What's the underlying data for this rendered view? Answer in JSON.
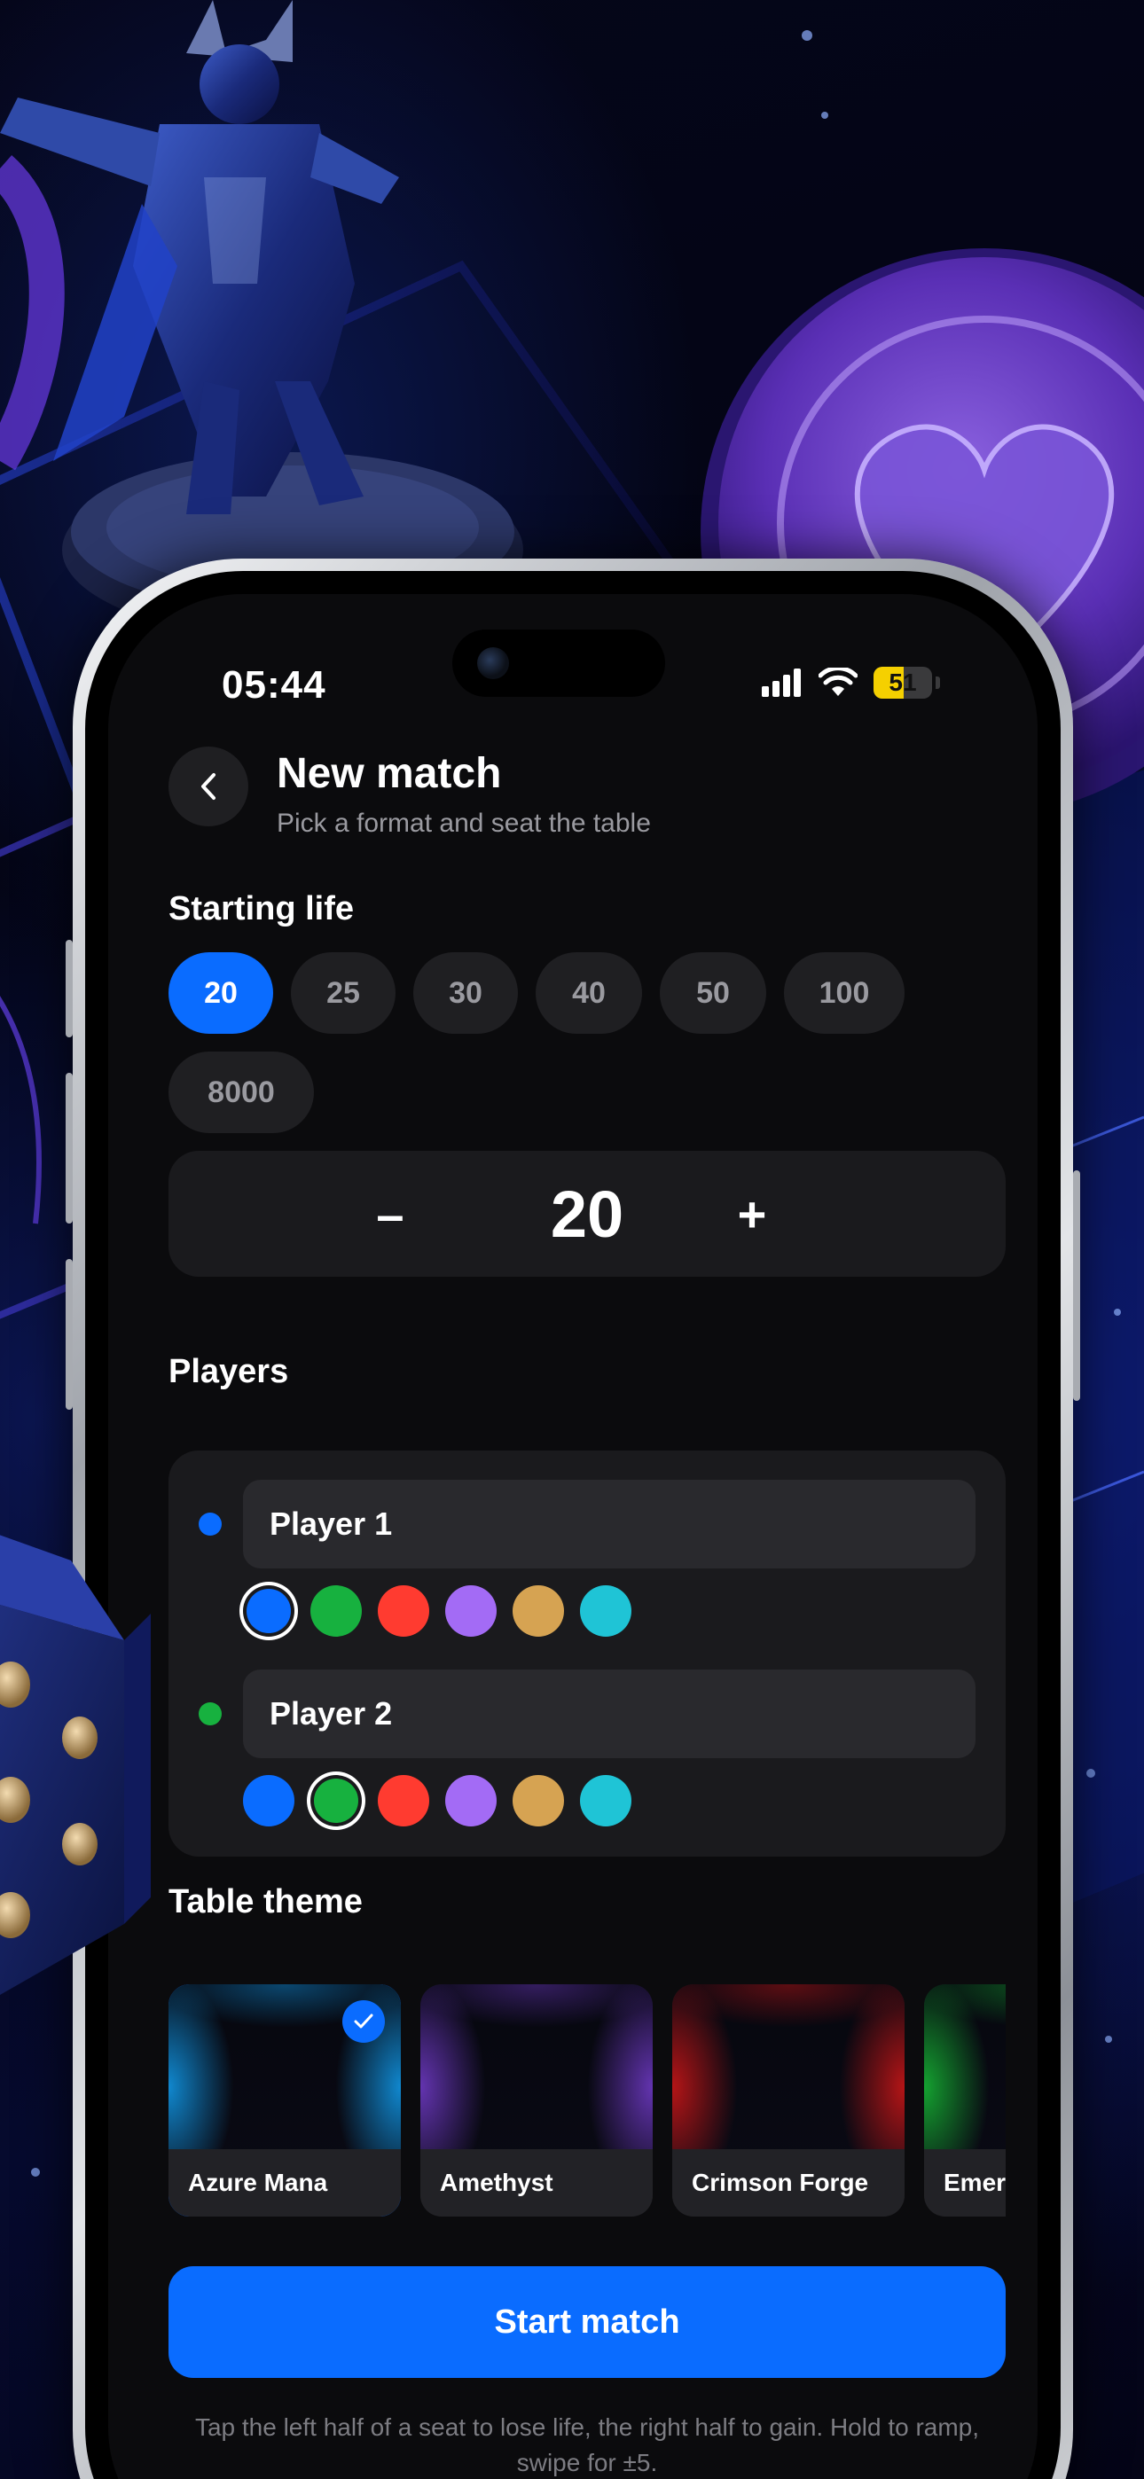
{
  "status_bar": {
    "time": "05:44",
    "battery": "51",
    "battery_level": 0.51
  },
  "header": {
    "title": "New match",
    "subtitle": "Pick a format and seat the table"
  },
  "starting_life": {
    "label": "Starting life",
    "options": [
      "20",
      "25",
      "30",
      "40",
      "50",
      "100",
      "8000"
    ],
    "selected": "20"
  },
  "stepper": {
    "minus": "–",
    "value": "20",
    "plus": "+"
  },
  "players": {
    "label": "Players",
    "palette": [
      "#0a6cff",
      "#17b13f",
      "#ff3b30",
      "#a36bf5",
      "#d6a352",
      "#1fc4d6"
    ],
    "list": [
      {
        "name": "Player 1",
        "color": "#0a6cff",
        "selected_swatch": 0
      },
      {
        "name": "Player 2",
        "color": "#17b13f",
        "selected_swatch": 1
      }
    ]
  },
  "table_theme": {
    "label": "Table theme",
    "themes": [
      {
        "name": "Azure Mana",
        "color": "#12a8ff",
        "selected": true
      },
      {
        "name": "Amethyst",
        "color": "#7a3fd8",
        "selected": false
      },
      {
        "name": "Crimson Forge",
        "color": "#e01818",
        "selected": false
      },
      {
        "name": "Emerald",
        "color": "#18c838",
        "selected": false
      }
    ]
  },
  "cta": {
    "start_label": "Start match"
  },
  "hint": "Tap the left half of a seat to lose life, the right half to gain. Hold to ramp, swipe for ±5.",
  "colors": {
    "accent": "#0a6cff",
    "surface": "#1a1a1d",
    "background": "#0b0b0d"
  }
}
